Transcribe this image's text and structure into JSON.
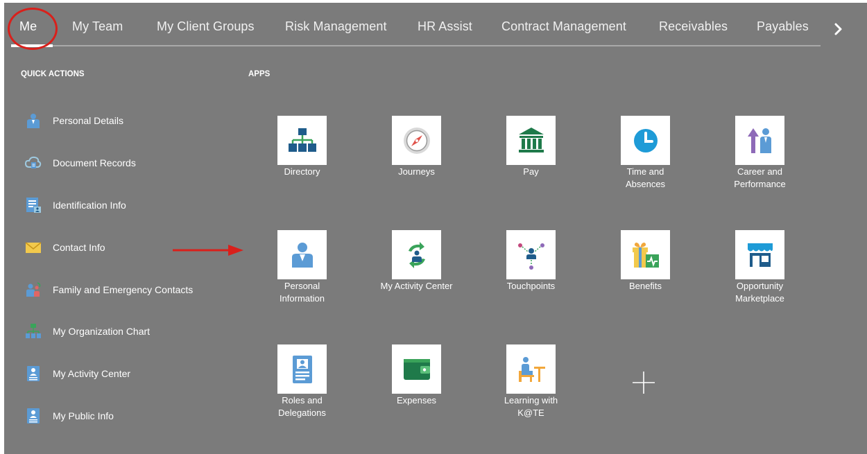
{
  "nav": {
    "tabs": [
      {
        "label": "Me"
      },
      {
        "label": "My Team"
      },
      {
        "label": "My Client Groups"
      },
      {
        "label": "Risk Management"
      },
      {
        "label": "HR Assist"
      },
      {
        "label": "Contract Management"
      },
      {
        "label": "Receivables"
      },
      {
        "label": "Payables"
      }
    ],
    "active_tab": "Me",
    "next_icon": "chevron-right-icon"
  },
  "quick_actions": {
    "title": "QUICK ACTIONS",
    "items": [
      {
        "label": "Personal Details",
        "icon": "person-icon"
      },
      {
        "label": "Document Records",
        "icon": "cloud-document-icon"
      },
      {
        "label": "Identification Info",
        "icon": "id-document-icon"
      },
      {
        "label": "Contact Info",
        "icon": "envelope-icon"
      },
      {
        "label": "Family and Emergency Contacts",
        "icon": "family-icon"
      },
      {
        "label": "My Organization Chart",
        "icon": "org-chart-icon"
      },
      {
        "label": "My Activity Center",
        "icon": "badge-icon"
      },
      {
        "label": "My Public Info",
        "icon": "badge-icon"
      }
    ]
  },
  "apps": {
    "title": "APPS",
    "items": [
      {
        "label": "Directory",
        "icon": "org-chart-icon"
      },
      {
        "label": "Journeys",
        "icon": "compass-icon"
      },
      {
        "label": "Pay",
        "icon": "bank-icon"
      },
      {
        "label": "Time and\nAbsences",
        "icon": "clock-icon"
      },
      {
        "label": "Career and\nPerformance",
        "icon": "career-arrow-icon"
      },
      {
        "label": "Personal\nInformation",
        "icon": "person-icon"
      },
      {
        "label": "My Activity Center",
        "icon": "activity-refresh-icon"
      },
      {
        "label": "Touchpoints",
        "icon": "touchpoints-icon"
      },
      {
        "label": "Benefits",
        "icon": "gift-icon"
      },
      {
        "label": "Opportunity\nMarketplace",
        "icon": "storefront-icon"
      },
      {
        "label": "Roles and\nDelegations",
        "icon": "id-badge-icon"
      },
      {
        "label": "Expenses",
        "icon": "wallet-icon"
      },
      {
        "label": "Learning with\nK@TE",
        "icon": "learning-desk-icon"
      }
    ],
    "add_icon": "plus-icon"
  },
  "annotations": {
    "highlight_color": "#d9201b"
  },
  "colors": {
    "background": "#7b7b7b",
    "icon_blue": "#5b9bd5",
    "icon_green": "#3aa35a",
    "icon_navy": "#1f5c8b"
  }
}
